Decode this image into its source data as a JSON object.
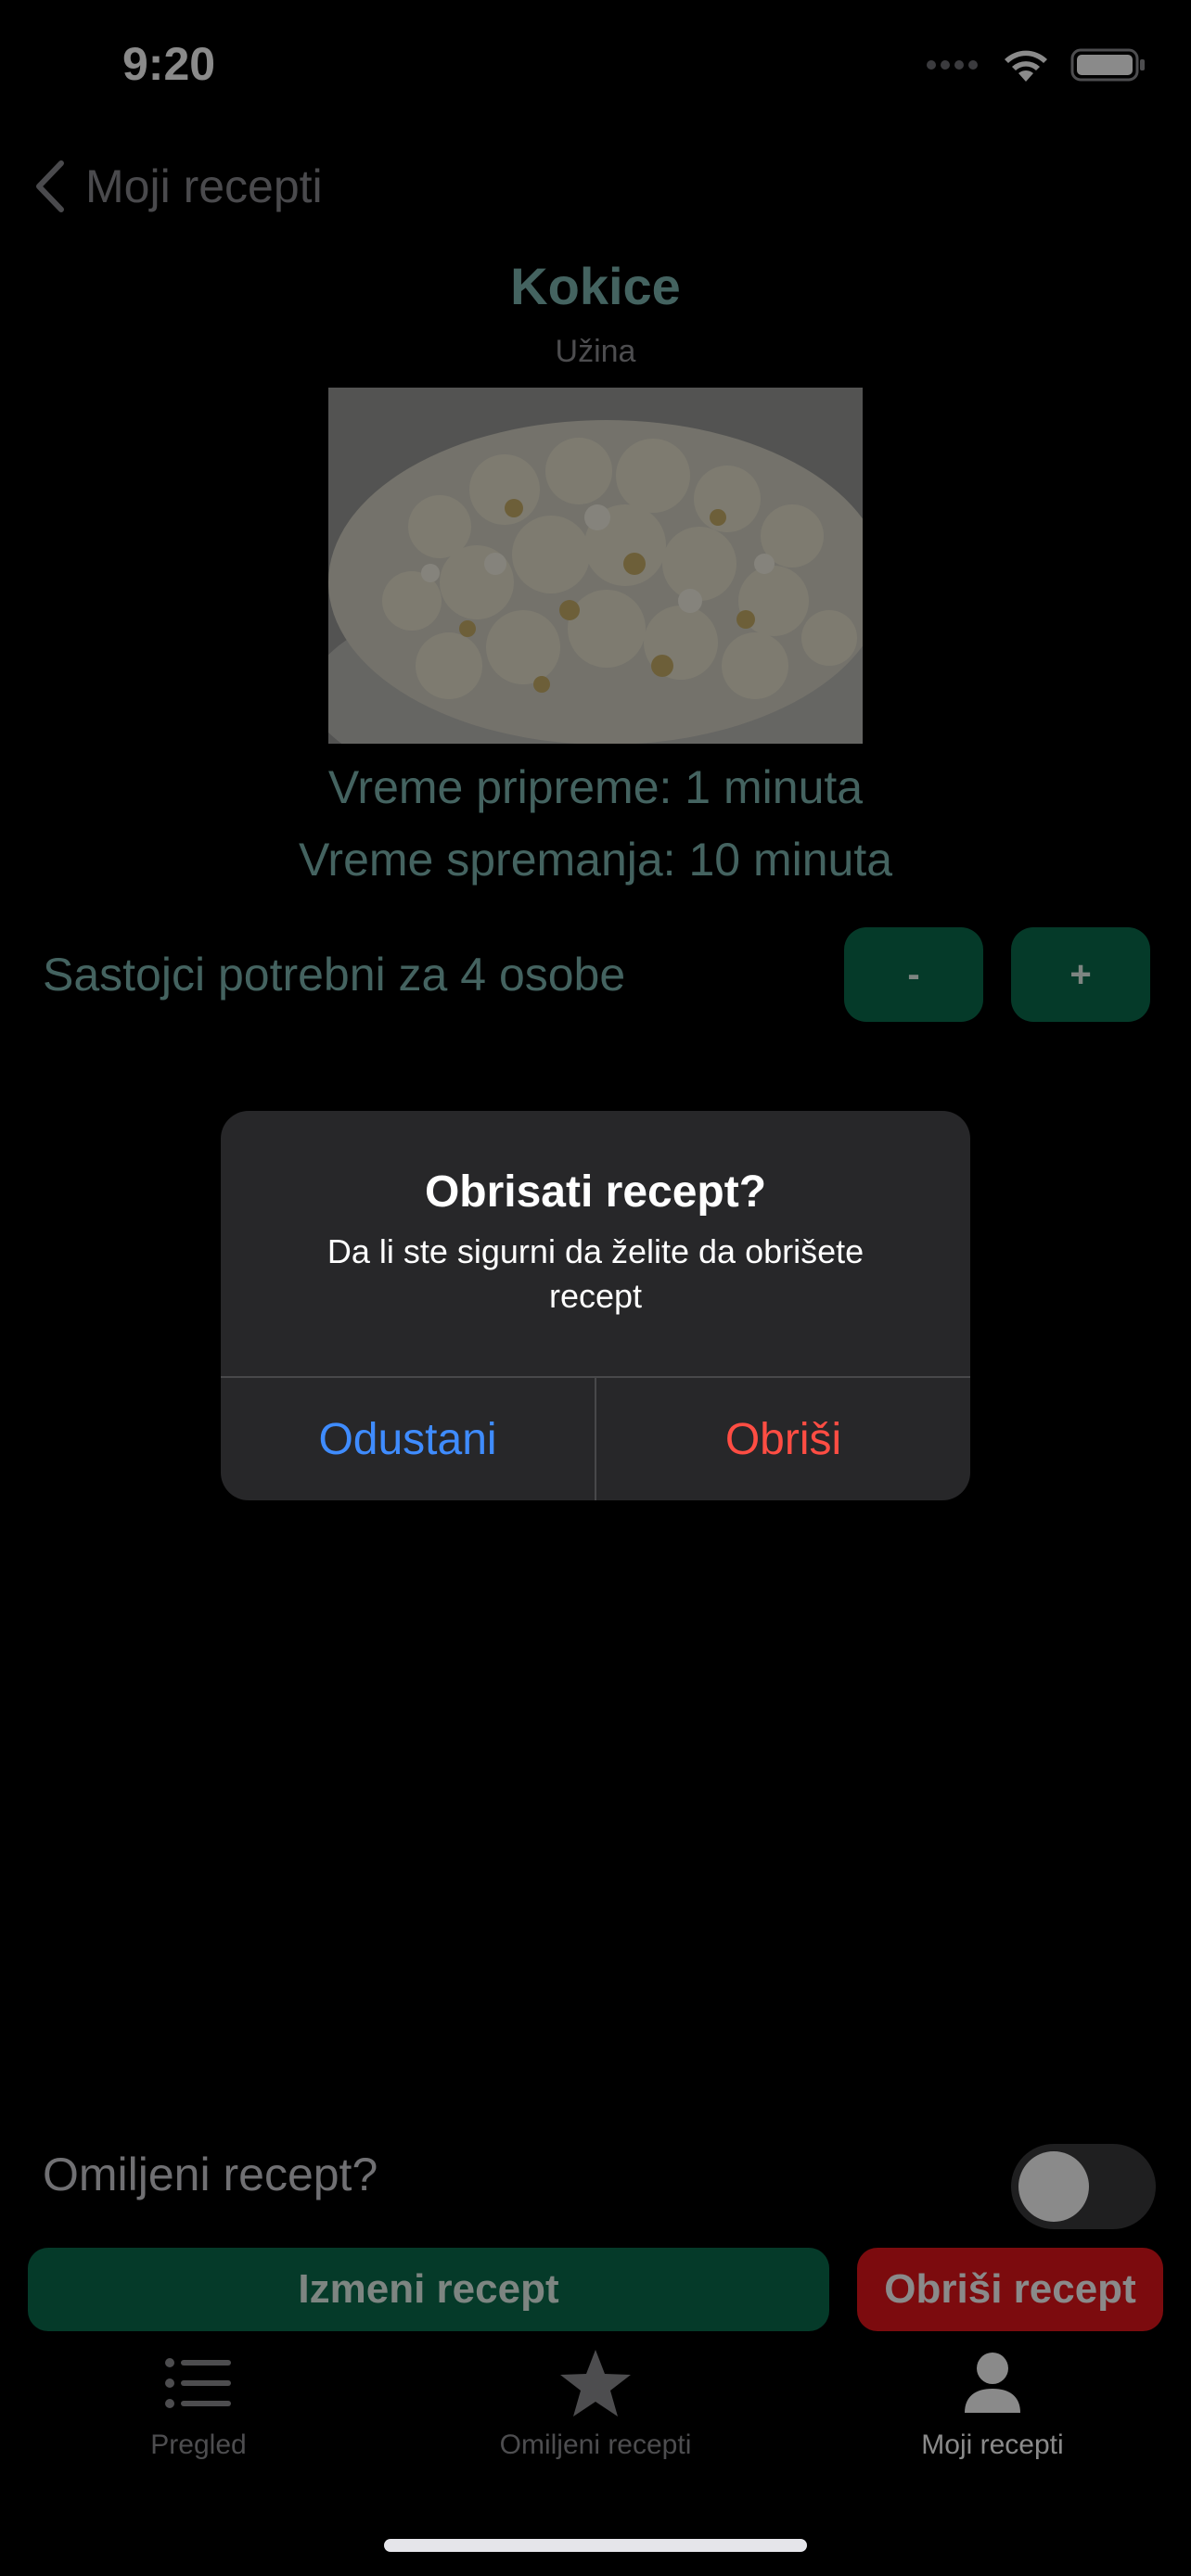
{
  "status": {
    "time": "9:20"
  },
  "nav": {
    "back_label": "Moji recepti"
  },
  "recipe": {
    "title": "Kokice",
    "category": "Užina",
    "prep_time": "Vreme pripreme: 1 minuta",
    "cook_time": "Vreme spremanja: 10 minuta",
    "ingredients_label": "Sastojci potrebni za 4 osobe",
    "minus_label": "-",
    "plus_label": "+",
    "favorite_label": "Omiljeni recept?",
    "favorite_on": false,
    "edit_label": "Izmeni recept",
    "delete_label": "Obriši recept"
  },
  "tabs": [
    {
      "label": "Pregled",
      "icon": "list-icon"
    },
    {
      "label": "Omiljeni recepti",
      "icon": "star-icon"
    },
    {
      "label": "Moji recepti",
      "icon": "person-icon"
    }
  ],
  "alert": {
    "title": "Obrisati recept?",
    "message": "Da li ste sigurni da želite da obrišete recept",
    "cancel_label": "Odustani",
    "confirm_label": "Obriši"
  },
  "colors": {
    "accent_green": "#0b6b4c",
    "title_teal": "#7fb7b2",
    "danger_red": "#e5151a",
    "alert_blue": "#3f8cff",
    "alert_red": "#ff4d43"
  }
}
